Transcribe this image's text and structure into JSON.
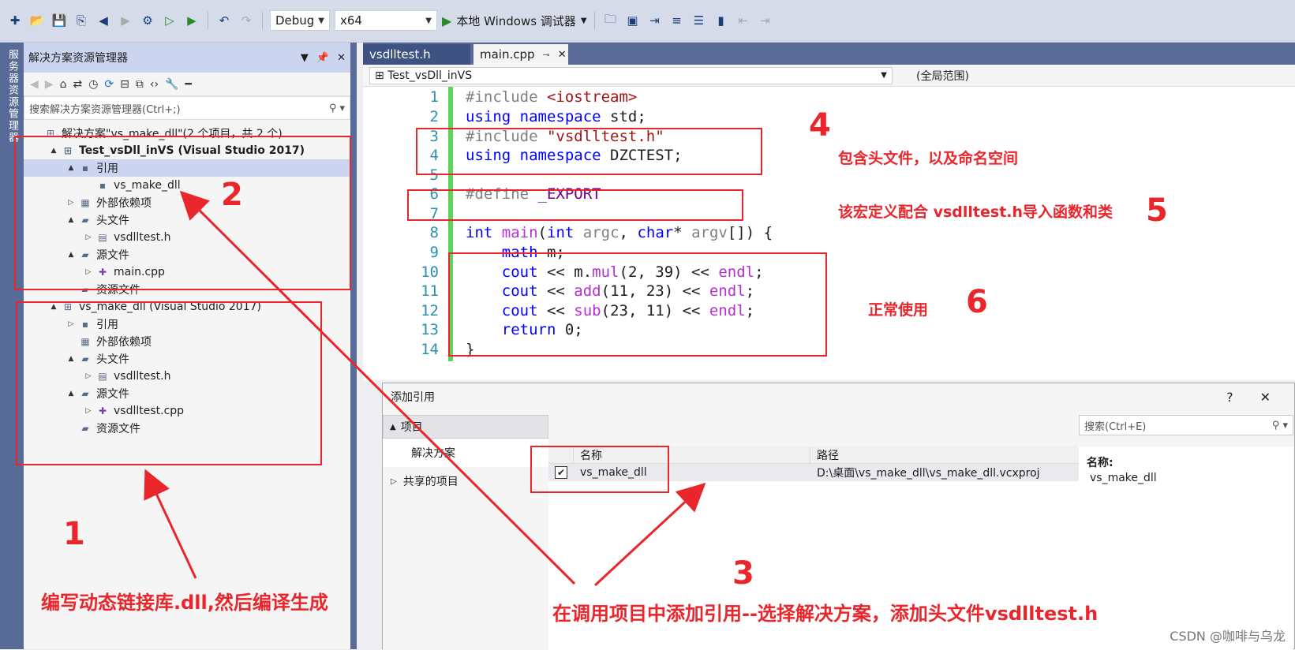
{
  "toolbar": {
    "config": "Debug",
    "platform": "x64",
    "run_label": "本地 Windows 调试器"
  },
  "side_tab": "服务器资源管理器",
  "explorer": {
    "title": "解决方案资源管理器",
    "search_placeholder": "搜索解决方案资源管理器(Ctrl+;)",
    "nodes": [
      {
        "label": "解决方案\"vs_make_dll\"(2 个项目，共 2 个)",
        "indent": 0,
        "exp": ""
      },
      {
        "label": "Test_vsDll_inVS (Visual Studio 2017)",
        "indent": 1,
        "exp": "▲"
      },
      {
        "label": "引用",
        "indent": 2,
        "exp": "▲"
      },
      {
        "label": "vs_make_dll",
        "indent": 3,
        "exp": ""
      },
      {
        "label": "外部依赖项",
        "indent": 2,
        "exp": "▷"
      },
      {
        "label": "头文件",
        "indent": 2,
        "exp": "▲"
      },
      {
        "label": "vsdlltest.h",
        "indent": 3,
        "exp": "▷"
      },
      {
        "label": "源文件",
        "indent": 2,
        "exp": "▲"
      },
      {
        "label": "main.cpp",
        "indent": 3,
        "exp": "▷"
      },
      {
        "label": "资源文件",
        "indent": 2,
        "exp": ""
      },
      {
        "label": "vs_make_dll (Visual Studio 2017)",
        "indent": 1,
        "exp": "▲"
      },
      {
        "label": "引用",
        "indent": 2,
        "exp": "▷"
      },
      {
        "label": "外部依赖项",
        "indent": 2,
        "exp": ""
      },
      {
        "label": "头文件",
        "indent": 2,
        "exp": "▲"
      },
      {
        "label": "vsdlltest.h",
        "indent": 3,
        "exp": "▷"
      },
      {
        "label": "源文件",
        "indent": 2,
        "exp": "▲"
      },
      {
        "label": "vsdlltest.cpp",
        "indent": 3,
        "exp": "▷"
      },
      {
        "label": "资源文件",
        "indent": 2,
        "exp": ""
      }
    ]
  },
  "tabs": [
    {
      "label": "vsdlltest.h"
    },
    {
      "label": "main.cpp"
    }
  ],
  "navbar": {
    "project": "Test_vsDll_inVS",
    "scope": "(全局范围)"
  },
  "dialog": {
    "title": "添加引用",
    "help": "?",
    "close": "✕",
    "group": "项目",
    "item_selected": "解决方案",
    "item_shared": "共享的项目",
    "col_name": "名称",
    "col_path": "路径",
    "row_name": "vs_make_dll",
    "row_path": "D:\\桌面\\vs_make_dll\\vs_make_dll.vcxproj",
    "search_placeholder": "搜索(Ctrl+E)",
    "prop_key": "名称:",
    "prop_val": "vs_make_dll"
  },
  "annotations": {
    "n1": "1",
    "n2": "2",
    "n3": "3",
    "n4": "4",
    "n5": "5",
    "n6": "6",
    "t1": "编写动态链接库.dll,然后编译生成",
    "t3": "在调用项目中添加引用--选择解决方案，添加头文件vsdlltest.h",
    "t4": "包含头文件，以及命名空间",
    "t5": "该宏定义配合 vsdlltest.h导入函数和类",
    "t6": "正常使用"
  },
  "watermark": "CSDN @咖啡与乌龙"
}
